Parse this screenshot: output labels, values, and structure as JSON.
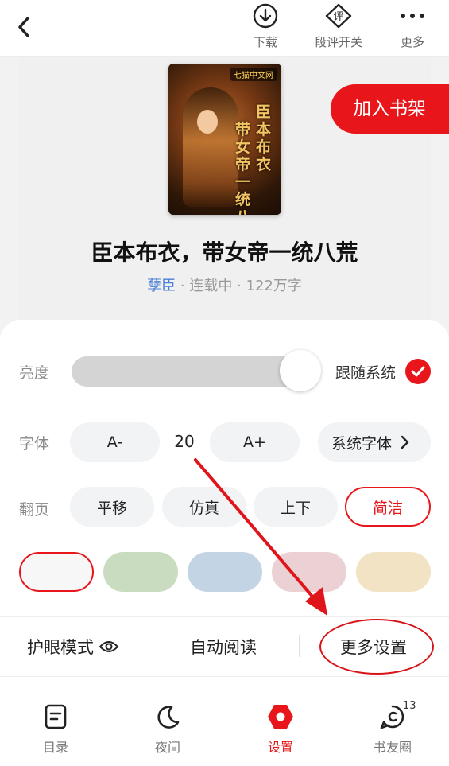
{
  "header": {
    "tools": [
      {
        "label": "下载",
        "icon": "download-icon"
      },
      {
        "label": "段评开关",
        "icon": "comment-toggle-icon",
        "icon_text": "评"
      },
      {
        "label": "更多",
        "icon": "more-icon"
      }
    ]
  },
  "book": {
    "cover_badge": "七猫中文网",
    "cover_title_right": "臣本布衣",
    "cover_title_left": "带女帝一统八荒",
    "add_to_shelf": "加入书架",
    "title": "臣本布衣，带女帝一统八荒",
    "author": "孽臣",
    "status": " · 连载中 · 122万字"
  },
  "settings": {
    "brightness": {
      "label": "亮度",
      "level": 0.87,
      "follow_system": "跟随系统",
      "follow_checked": true
    },
    "font": {
      "label": "字体",
      "decrease": "A-",
      "size": "20",
      "increase": "A+",
      "family": "系统字体"
    },
    "page_turn": {
      "label": "翻页",
      "options": [
        "平移",
        "仿真",
        "上下",
        "简洁"
      ],
      "selected": "简洁"
    },
    "backgrounds": {
      "colors": [
        "#f7f7f7",
        "#c9dcbf",
        "#c3d5e4",
        "#ecd1d4",
        "#f2e3c4"
      ],
      "selected_index": 0
    },
    "bottom_options": {
      "eye_care": "护眼模式",
      "auto_read": "自动阅读",
      "more_settings": "更多设置"
    }
  },
  "tabbar": {
    "items": [
      {
        "label": "目录",
        "icon": "catalog-icon"
      },
      {
        "label": "夜间",
        "icon": "moon-icon"
      },
      {
        "label": "设置",
        "icon": "settings-icon",
        "active": true
      },
      {
        "label": "书友圈",
        "icon": "book-friends-icon",
        "badge": "13"
      }
    ]
  },
  "colors": {
    "accent": "#e8161a",
    "author_link": "#4a7fd6"
  }
}
